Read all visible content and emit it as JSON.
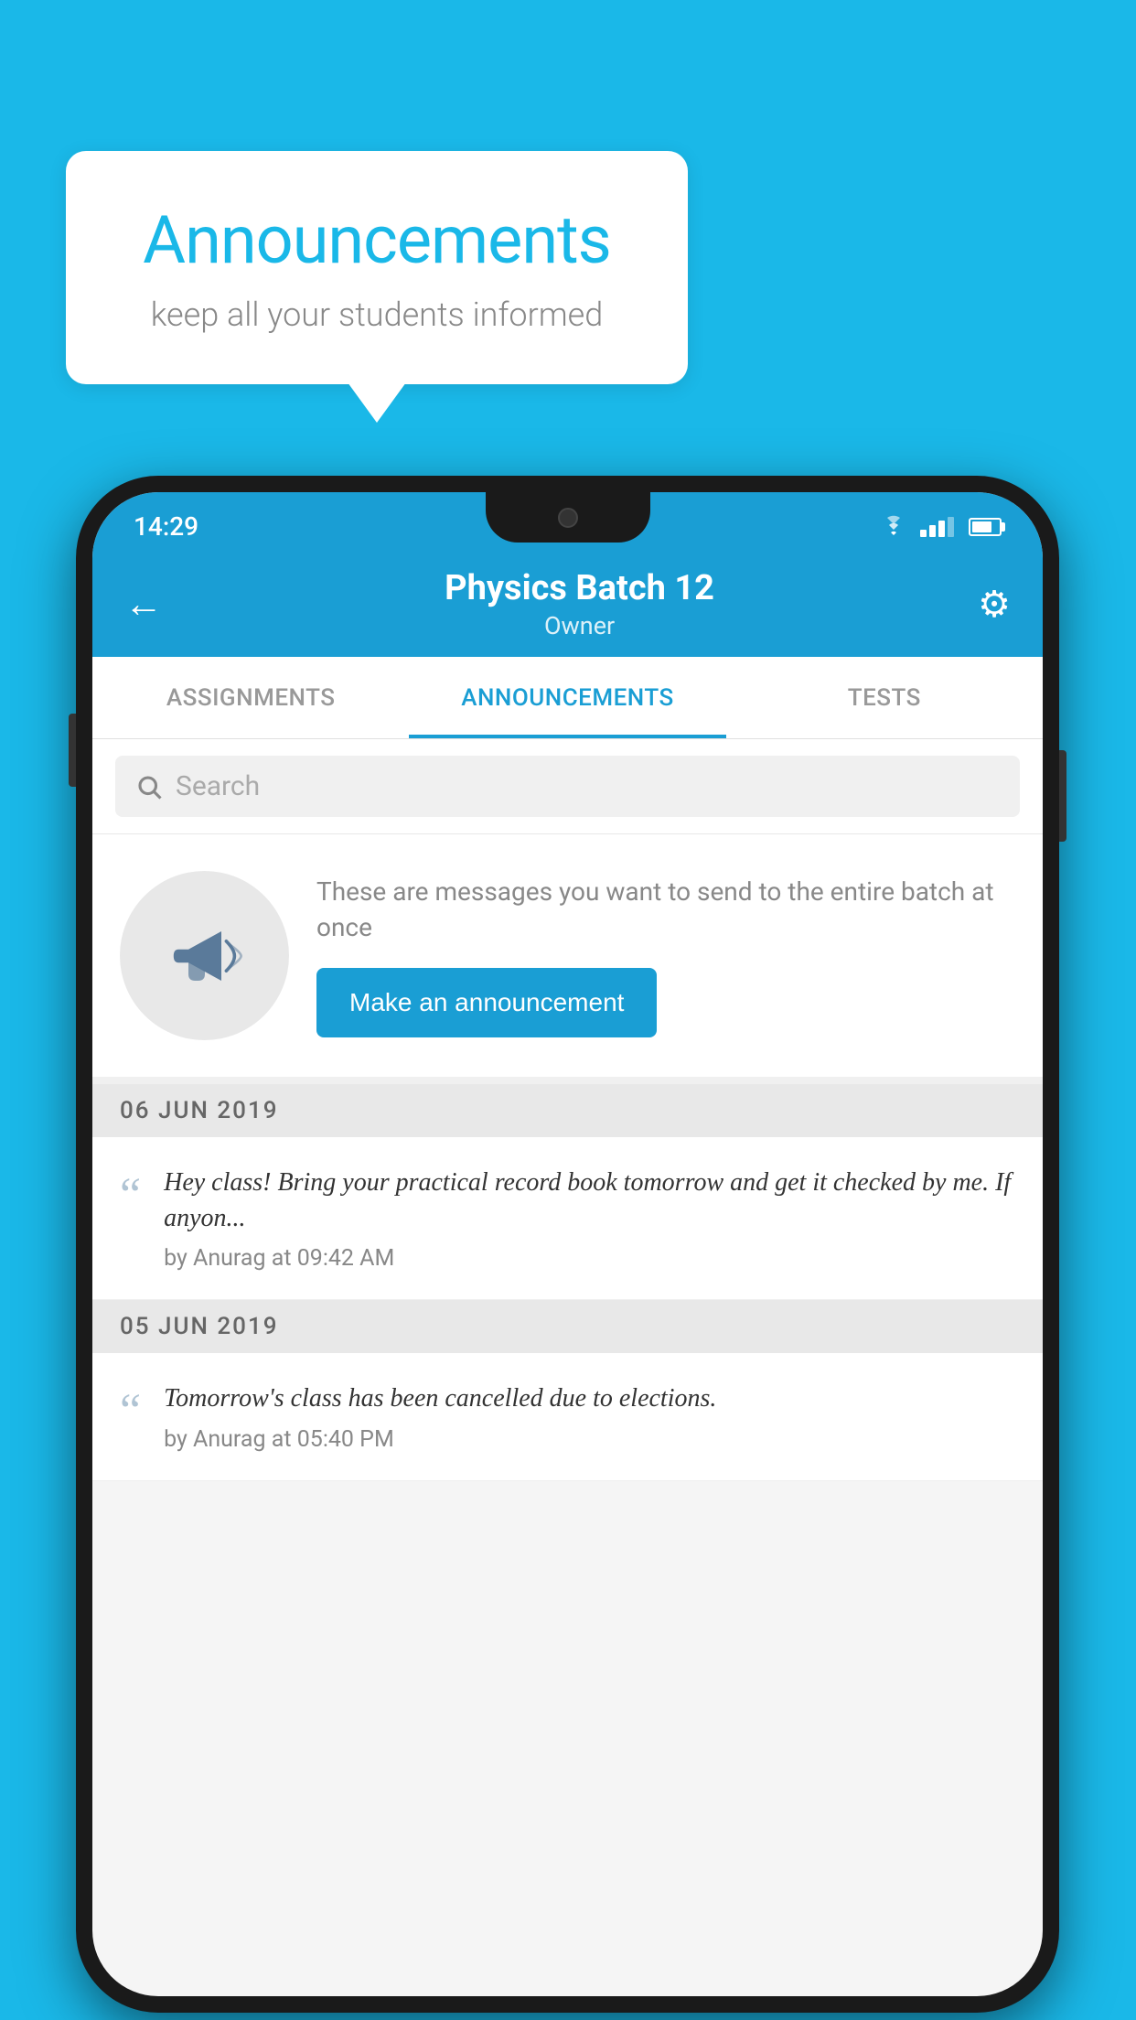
{
  "background": {
    "color": "#1ab8e8"
  },
  "speechBubble": {
    "title": "Announcements",
    "subtitle": "keep all your students informed"
  },
  "phone": {
    "statusBar": {
      "time": "14:29"
    },
    "appBar": {
      "title": "Physics Batch 12",
      "subtitle": "Owner",
      "backLabel": "←",
      "settingsLabel": "⚙"
    },
    "tabs": [
      {
        "label": "ASSIGNMENTS",
        "active": false
      },
      {
        "label": "ANNOUNCEMENTS",
        "active": true
      },
      {
        "label": "TESTS",
        "active": false
      }
    ],
    "search": {
      "placeholder": "Search"
    },
    "promoBlock": {
      "description": "These are messages you want to send to the entire batch at once",
      "buttonLabel": "Make an announcement"
    },
    "announcements": [
      {
        "date": "06  JUN  2019",
        "text": "Hey class! Bring your practical record book tomorrow and get it checked by me. If anyon...",
        "meta": "by Anurag at 09:42 AM"
      },
      {
        "date": "05  JUN  2019",
        "text": "Tomorrow's class has been cancelled due to elections.",
        "meta": "by Anurag at 05:40 PM"
      }
    ]
  }
}
